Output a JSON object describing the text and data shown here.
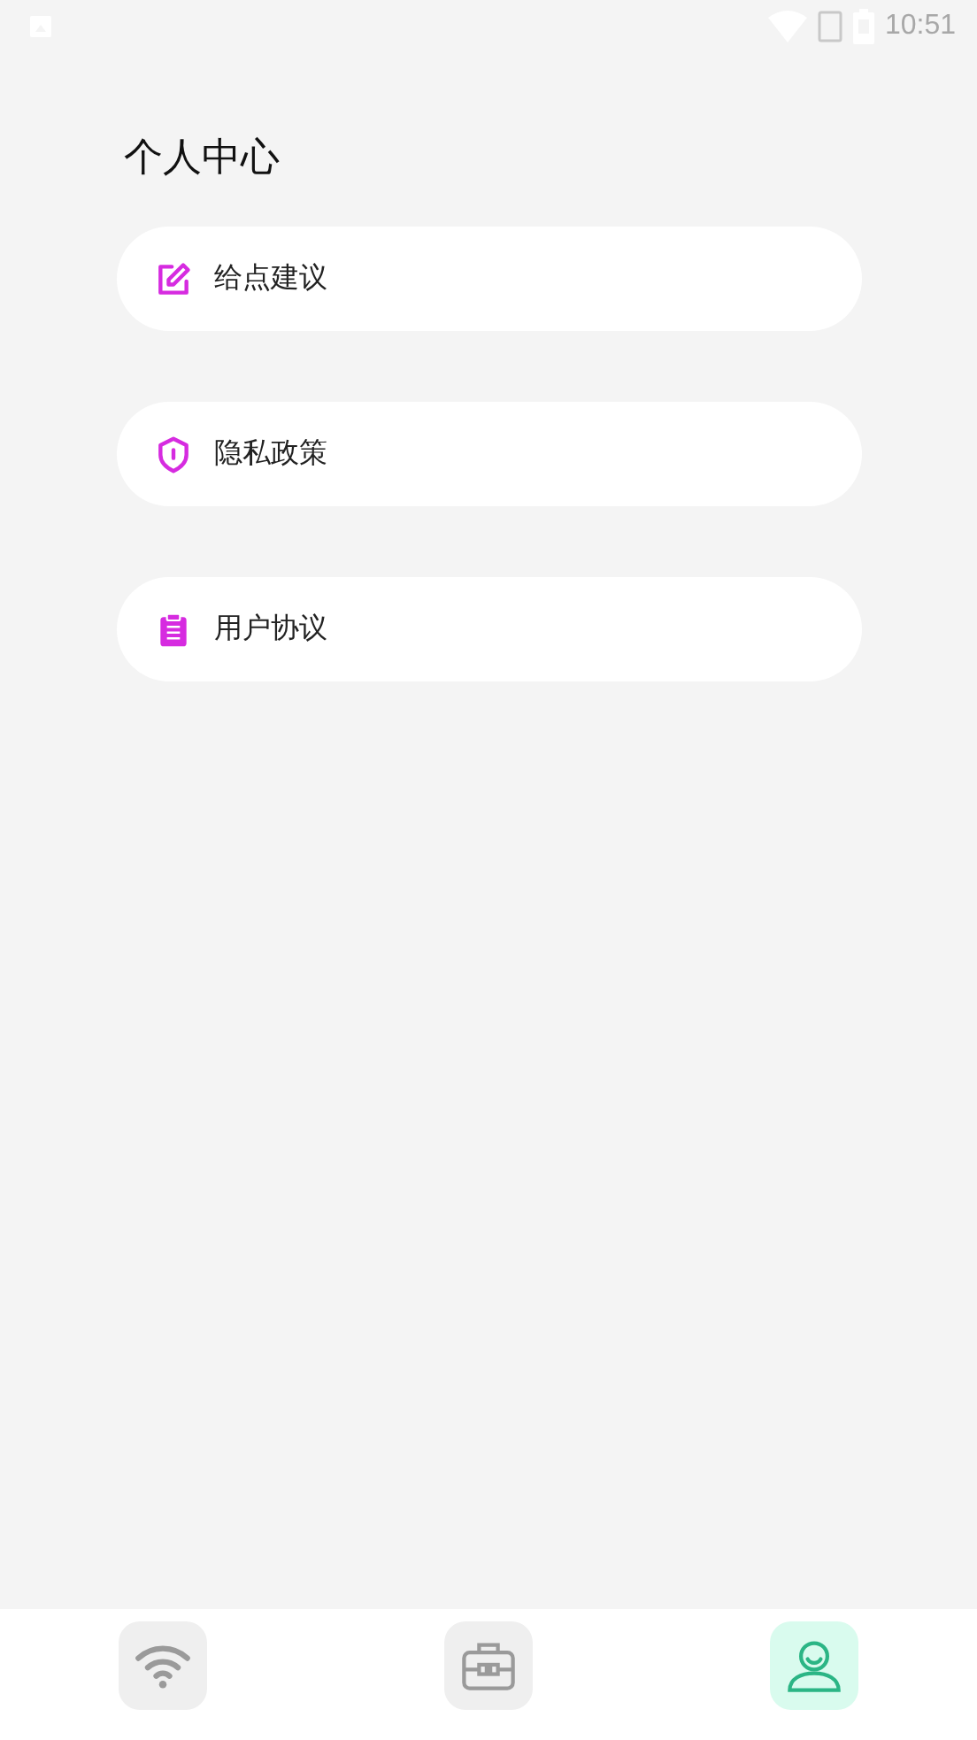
{
  "status_bar": {
    "time": "10:51"
  },
  "title": "个人中心",
  "menu": [
    {
      "kind": "feedback",
      "label": "给点建议"
    },
    {
      "kind": "privacy",
      "label": "隐私政策"
    },
    {
      "kind": "agreement",
      "label": "用户协议"
    }
  ],
  "bottom_nav": [
    {
      "kind": "wifi",
      "selected": false
    },
    {
      "kind": "toolbox",
      "selected": false
    },
    {
      "kind": "profile",
      "selected": true
    }
  ]
}
